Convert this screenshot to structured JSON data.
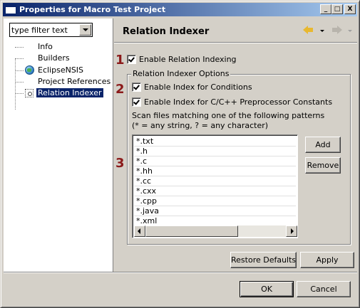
{
  "window": {
    "title": "Properties for Macro Test Project",
    "minimize_glyph": "_",
    "maximize_glyph": "□",
    "close_glyph": "X"
  },
  "sidebar": {
    "filter": {
      "value": "type filter text",
      "placeholder": "type filter text"
    },
    "items": [
      {
        "label": "Info",
        "icon": "none",
        "selected": false
      },
      {
        "label": "Builders",
        "icon": "none",
        "selected": false
      },
      {
        "label": "EclipseNSIS",
        "icon": "globe-icon",
        "selected": false
      },
      {
        "label": "Project References",
        "icon": "none",
        "selected": false
      },
      {
        "label": "Relation Indexer",
        "icon": "gear-icon",
        "selected": true
      }
    ]
  },
  "page": {
    "title": "Relation Indexer",
    "enable_relation_indexing": {
      "label": "Enable Relation Indexing",
      "checked": true
    },
    "options_group_label": "Relation Indexer Options",
    "index_conditions": {
      "label": "Enable Index for Conditions",
      "checked": true
    },
    "index_preprocessor": {
      "label": "Enable Index for C/C++ Preprocessor Constants",
      "checked": true
    },
    "scan_desc_line1": "Scan files matching one of the following patterns",
    "scan_desc_line2": "(* = any string, ? = any character)",
    "patterns": [
      "*.txt",
      "*.h",
      "*.c",
      "*.hh",
      "*.cc",
      "*.cxx",
      "*.cpp",
      "*.java",
      "*.xml"
    ],
    "add_label": "Add",
    "remove_label": "Remove",
    "restore_defaults_label": "Restore Defaults",
    "apply_label": "Apply"
  },
  "markers": [
    "1",
    "2",
    "3"
  ],
  "dialog": {
    "ok_label": "OK",
    "cancel_label": "Cancel"
  },
  "colors": {
    "title_gradient_start": "#0a246a",
    "title_gradient_end": "#a6caf0",
    "selection": "#0a246a",
    "marker": "#8b1a1a",
    "face": "#d4d0c8"
  }
}
